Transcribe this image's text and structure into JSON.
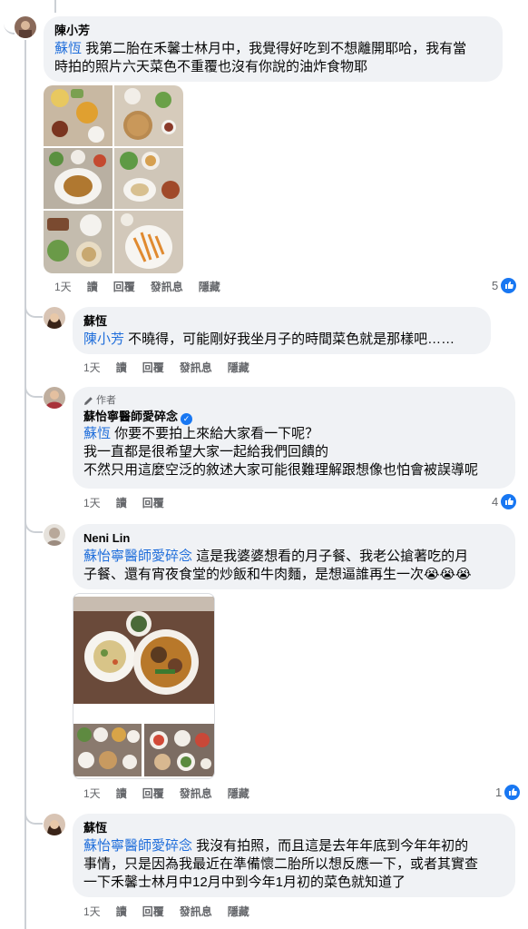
{
  "labels": {
    "day": "1天",
    "read": "讀",
    "reply": "回覆",
    "message": "發訊息",
    "hide": "隱藏",
    "author_badge": "作者"
  },
  "comments": [
    {
      "author": "陳小芳",
      "mention": "蘇恆",
      "text_line1": " 我第二胎在禾馨士林月中，我覺得好吃到不想離開耶哈，我有當",
      "text_line2": "時拍的照片六天菜色不重覆也沒有你說的油炸食物耶",
      "reactions": "5"
    },
    {
      "author": "蘇恆",
      "mention": "陳小芳",
      "text_line1": " 不曉得，可能剛好我坐月子的時間菜色就是那樣吧……"
    },
    {
      "author": "蘇怡寧醫師愛碎念",
      "mention": "蘇恆",
      "text_line1": " 你要不要拍上來給大家看一下呢？",
      "text_line2": "我一直都是很希望大家一起給我們回饋的",
      "text_line3": "不然只用這麼空泛的敘述大家可能很難理解跟想像也怕會被誤導呢",
      "reactions": "4"
    },
    {
      "author": "Neni Lin",
      "mention": "蘇怡寧醫師愛碎念",
      "text_line1": " 這是我婆婆想看的月子餐、我老公搶著吃的月",
      "text_line2": "子餐、還有宵夜食堂的炒飯和牛肉麵，是想逼誰再生一次😭😭😭",
      "reactions": "1"
    },
    {
      "author": "蘇恆",
      "mention": "蘇怡寧醫師愛碎念",
      "text_line1": " 我沒有拍照，而且這是去年年底到今年年初的",
      "text_line2": "事情，只是因為我最近在準備懷二胎所以想反應一下，或者其實查",
      "text_line3": "一下禾馨士林月中12月中到今年1月初的菜色就知道了"
    }
  ],
  "colors": {
    "bubble": "#f0f2f5",
    "mention": "#216fdb",
    "like": "#1877f2",
    "meta": "#65676b"
  }
}
